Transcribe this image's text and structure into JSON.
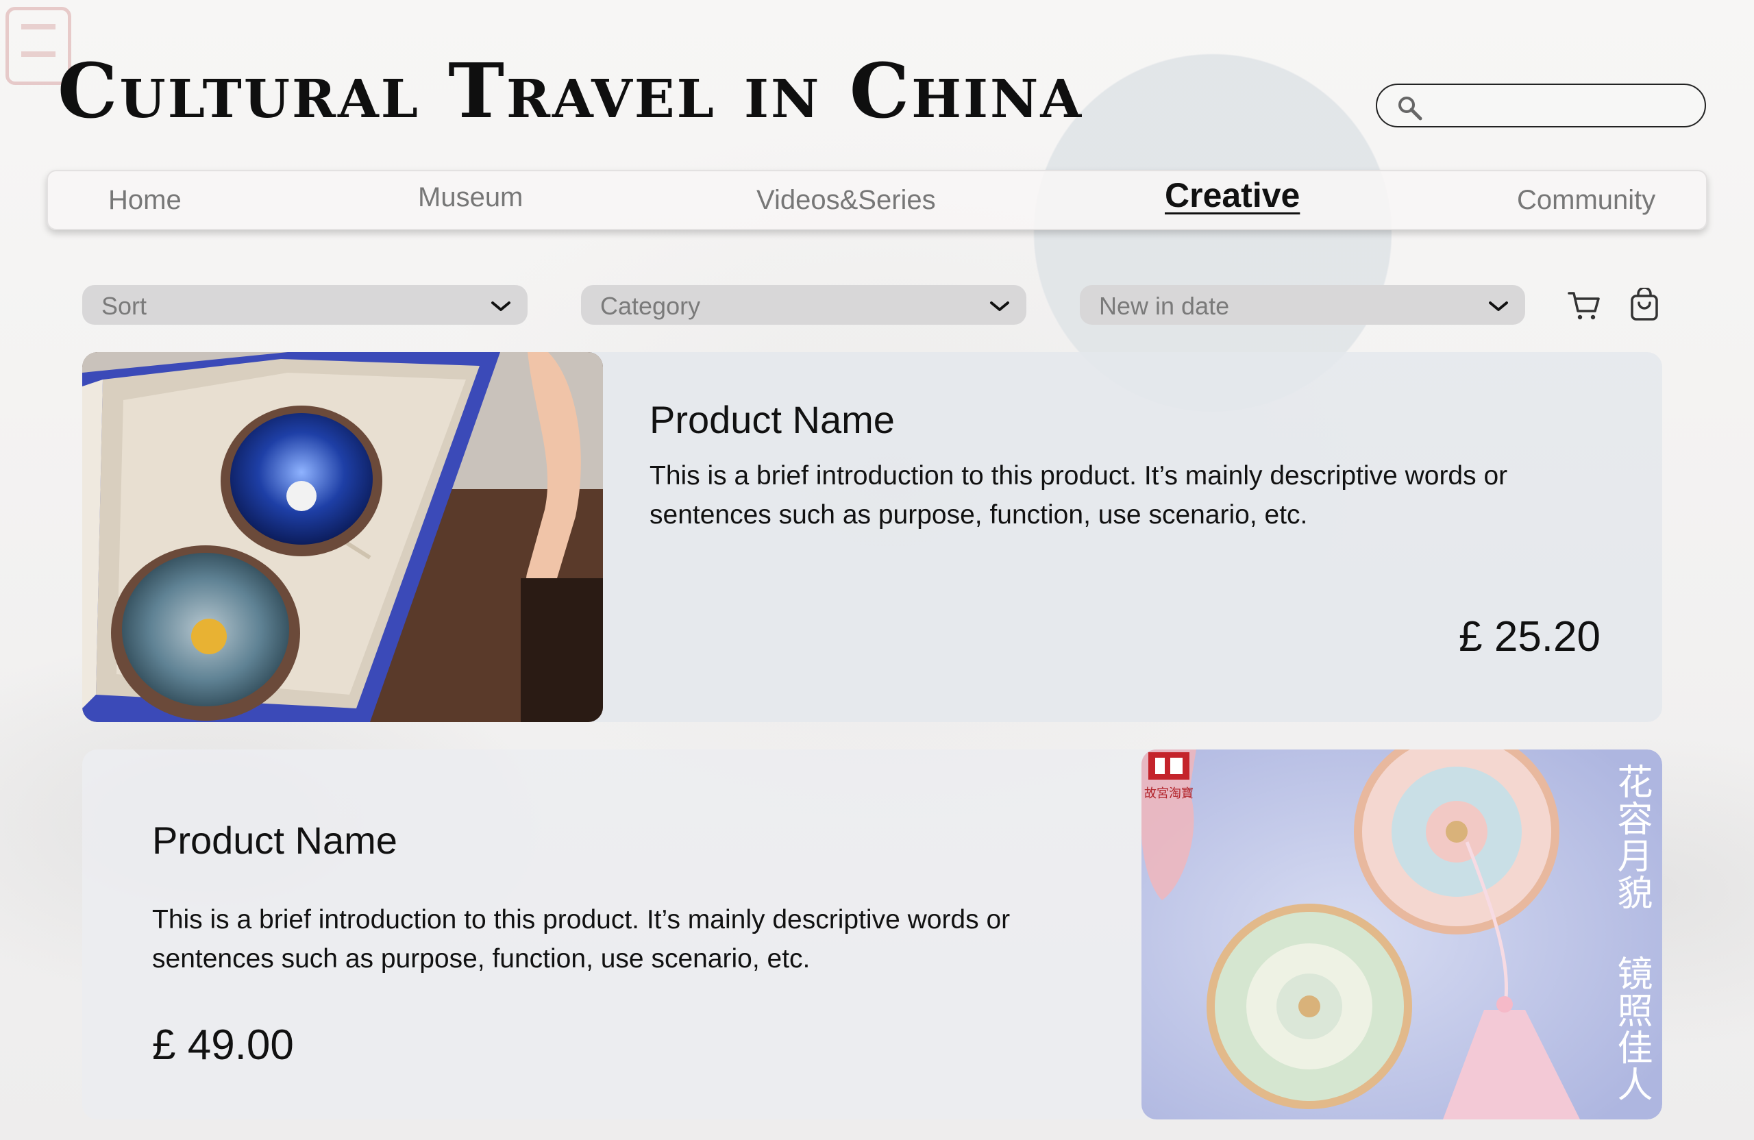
{
  "site": {
    "title": "Cultural Travel in China"
  },
  "search": {
    "placeholder": "",
    "value": ""
  },
  "nav": {
    "items": [
      {
        "label": "Home",
        "active": false
      },
      {
        "label": "Museum",
        "active": false
      },
      {
        "label": "Videos&Series",
        "active": false
      },
      {
        "label": "Creative",
        "active": true
      },
      {
        "label": "Community",
        "active": false
      }
    ]
  },
  "filters": [
    {
      "label": "Sort"
    },
    {
      "label": "Category"
    },
    {
      "label": "New in date"
    }
  ],
  "icons": {
    "search": "search-icon",
    "chevron": "chevron-down-icon",
    "cart": "cart-icon",
    "bag": "shopping-bag-icon"
  },
  "products": [
    {
      "name": "Product Name",
      "description": "This is a brief introduction to this product. It’s mainly descriptive words or sentences such as purpose, function, use scenario, etc.",
      "price": "£ 25.20",
      "image": "tea-cups-gift-box"
    },
    {
      "name": "Product Name",
      "description": "This is a brief introduction to this product. It’s mainly descriptive words or sentences such as purpose, function, use scenario, etc.",
      "price": "£ 49.00",
      "image": "enamel-mirrors-with-tassel",
      "image_text_left": "故宮淘寶",
      "image_text_right_1": "花容月貌",
      "image_text_right_2": "镜照佳人"
    }
  ],
  "colors": {
    "accent": "#111111",
    "nav_inactive": "#777777",
    "filter_bg": "#d8d7d8",
    "card_bg": "#e4e8ec"
  }
}
